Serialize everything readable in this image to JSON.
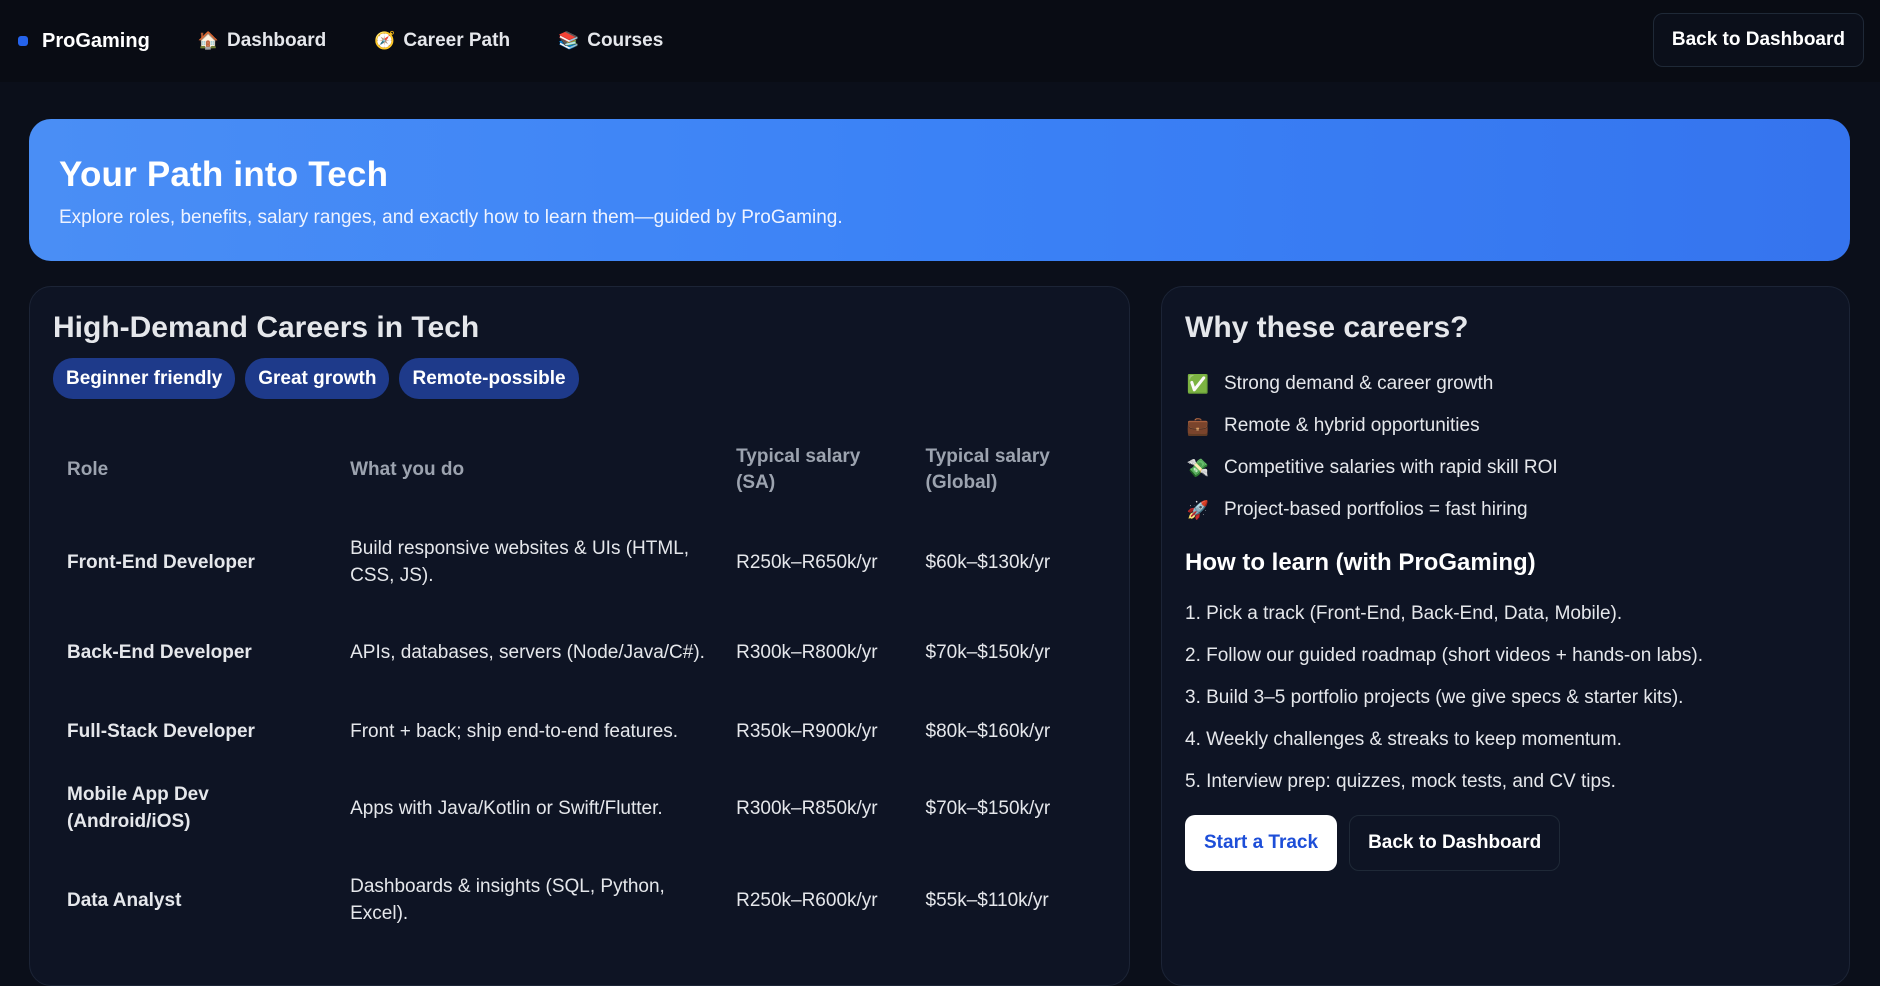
{
  "nav": {
    "brand": "ProGaming",
    "links": [
      {
        "icon": "🏠",
        "icon_name": "house-icon",
        "label": "Dashboard"
      },
      {
        "icon": "🧭",
        "icon_name": "compass-icon",
        "label": "Career Path"
      },
      {
        "icon": "📚",
        "icon_name": "books-icon",
        "label": "Courses"
      }
    ],
    "back_button": "Back to Dashboard"
  },
  "hero": {
    "title": "Your Path into Tech",
    "subtitle": "Explore roles, benefits, salary ranges, and exactly how to learn them—guided by ProGaming."
  },
  "careers": {
    "title": "High-Demand Careers in Tech",
    "tags": [
      "Beginner friendly",
      "Great growth",
      "Remote-possible"
    ],
    "columns": [
      "Role",
      "What you do",
      "Typical salary (SA)",
      "Typical salary (Global)"
    ],
    "rows": [
      {
        "role": "Front-End Developer",
        "what": "Build responsive websites & UIs (HTML, CSS, JS).",
        "sa": "R250k–R650k/yr",
        "global": "$60k–$130k/yr"
      },
      {
        "role": "Back-End Developer",
        "what": "APIs, databases, servers (Node/Java/C#).",
        "sa": "R300k–R800k/yr",
        "global": "$70k–$150k/yr"
      },
      {
        "role": "Full-Stack Developer",
        "what": "Front + back; ship end-to-end features.",
        "sa": "R350k–R900k/yr",
        "global": "$80k–$160k/yr"
      },
      {
        "role": "Mobile App Dev (Android/iOS)",
        "what": "Apps with Java/Kotlin or Swift/Flutter.",
        "sa": "R300k–R850k/yr",
        "global": "$70k–$150k/yr"
      },
      {
        "role": "Data Analyst",
        "what": "Dashboards & insights (SQL, Python, Excel).",
        "sa": "R250k–R600k/yr",
        "global": "$55k–$110k/yr"
      }
    ]
  },
  "why": {
    "title": "Why these careers?",
    "items": [
      {
        "icon": "✅",
        "icon_name": "check-icon",
        "text": "Strong demand & career growth"
      },
      {
        "icon": "💼",
        "icon_name": "briefcase-icon",
        "text": "Remote & hybrid opportunities"
      },
      {
        "icon": "💸",
        "icon_name": "money-icon",
        "text": "Competitive salaries with rapid skill ROI"
      },
      {
        "icon": "🚀",
        "icon_name": "rocket-icon",
        "text": "Project-based portfolios = fast hiring"
      }
    ],
    "learn_title": "How to learn (with ProGaming)",
    "steps": [
      "1. Pick a track (Front-End, Back-End, Data, Mobile).",
      "2. Follow our guided roadmap (short videos + hands-on labs).",
      "3. Build 3–5 portfolio projects (we give specs & starter kits).",
      "4. Weekly challenges & streaks to keep momentum.",
      "5. Interview prep: quizzes, mock tests, and CV tips."
    ],
    "start_button": "Start a Track",
    "back_button": "Back to Dashboard"
  },
  "colors": {
    "background": "#0b0f1a",
    "hero_blue": "#3b82f6",
    "accent": "#2563eb",
    "pill": "#1e3a8a",
    "card": "#0e1424"
  }
}
